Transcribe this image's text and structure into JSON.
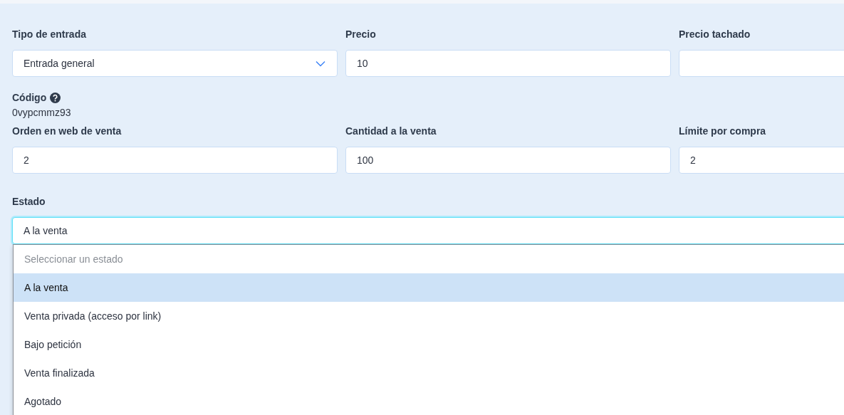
{
  "row1": [
    {
      "label": "Tipo de entrada",
      "kind": "select",
      "value": "Entrada general"
    },
    {
      "label": "Precio",
      "kind": "input",
      "value": "10"
    },
    {
      "label": "Precio tachado",
      "kind": "input"
    }
  ],
  "code": {
    "label": "Código",
    "value": "0vypcmmz93"
  },
  "row2": [
    {
      "label": "Orden en web de venta",
      "kind": "input",
      "value": "2"
    },
    {
      "label": "Cantidad a la venta",
      "kind": "input",
      "value": "100"
    },
    {
      "label": "Límite por compra",
      "kind": "input",
      "value": "2"
    }
  ],
  "estado": {
    "label": "Estado",
    "value": "A la venta",
    "options": [
      {
        "label": "Seleccionar un estado",
        "kind": "placeholder",
        "selected": false
      },
      {
        "label": "A la venta",
        "kind": "option",
        "selected": true
      },
      {
        "label": "Venta privada (acceso por link)",
        "kind": "option",
        "selected": false
      },
      {
        "label": "Bajo petición",
        "kind": "option",
        "selected": false
      },
      {
        "label": "Venta finalizada",
        "kind": "option",
        "selected": false
      },
      {
        "label": "Agotado",
        "kind": "option",
        "selected": false
      }
    ]
  }
}
